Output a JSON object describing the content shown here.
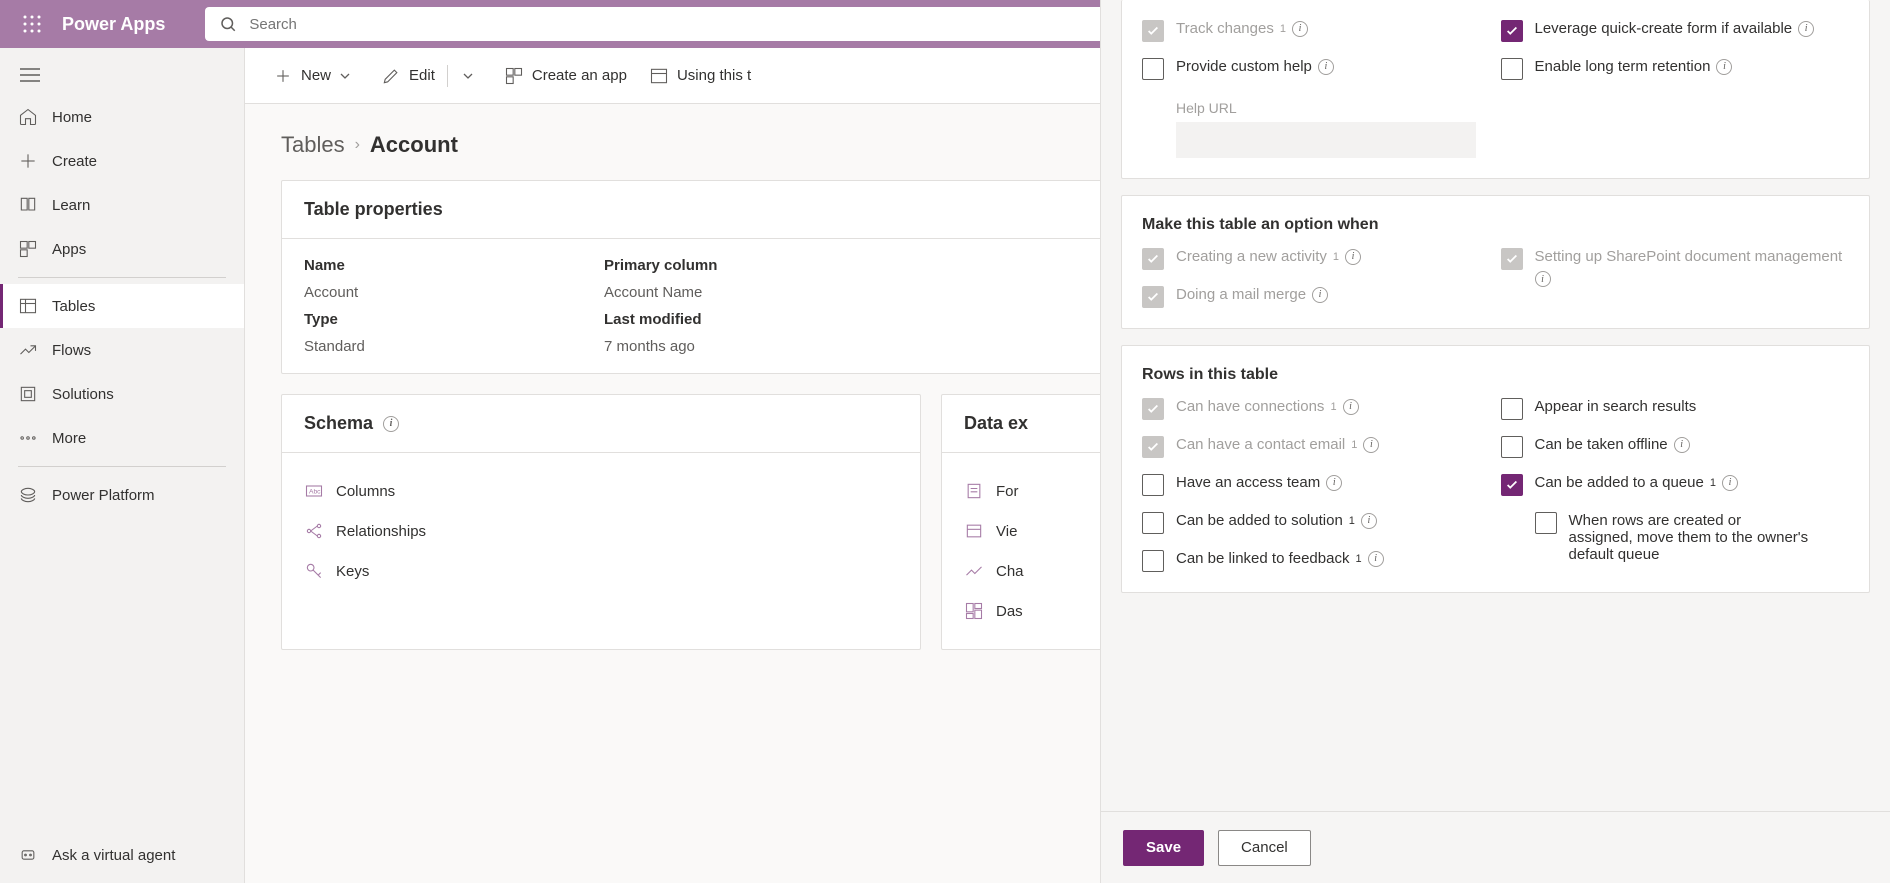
{
  "header": {
    "brand": "Power Apps",
    "search_placeholder": "Search"
  },
  "nav": {
    "home": "Home",
    "create": "Create",
    "learn": "Learn",
    "apps": "Apps",
    "tables": "Tables",
    "flows": "Flows",
    "solutions": "Solutions",
    "more": "More",
    "power_platform": "Power Platform",
    "ask_agent": "Ask a virtual agent"
  },
  "commands": {
    "new": "New",
    "edit": "Edit",
    "create_app": "Create an app",
    "using_this": "Using this t"
  },
  "breadcrumb": {
    "root": "Tables",
    "current": "Account"
  },
  "props_card": {
    "title": "Table properties",
    "name_label": "Name",
    "name_value": "Account",
    "type_label": "Type",
    "type_value": "Standard",
    "primary_label": "Primary column",
    "primary_value": "Account Name",
    "modified_label": "Last modified",
    "modified_value": "7 months ago"
  },
  "schema_card": {
    "title": "Schema",
    "columns": "Columns",
    "relationships": "Relationships",
    "keys": "Keys"
  },
  "data_card": {
    "title": "Data ex",
    "forms": "For",
    "views": "Vie",
    "charts": "Cha",
    "dashboards": "Das"
  },
  "panel": {
    "track_changes": "Track changes",
    "provide_help": "Provide custom help",
    "help_url": "Help URL",
    "leverage_quick": "Leverage quick-create form if available",
    "long_term": "Enable long term retention",
    "section_option": "Make this table an option when",
    "creating_activity": "Creating a new activity",
    "mail_merge": "Doing a mail merge",
    "sharepoint": "Setting up SharePoint document management",
    "section_rows": "Rows in this table",
    "connections": "Can have connections",
    "contact_email": "Can have a contact email",
    "access_team": "Have an access team",
    "added_solution": "Can be added to solution",
    "linked_feedback": "Can be linked to feedback",
    "appear_search": "Appear in search results",
    "taken_offline": "Can be taken offline",
    "added_queue": "Can be added to a queue",
    "move_queue": "When rows are created or assigned, move them to the owner's default queue",
    "save": "Save",
    "cancel": "Cancel",
    "sup": "1"
  }
}
